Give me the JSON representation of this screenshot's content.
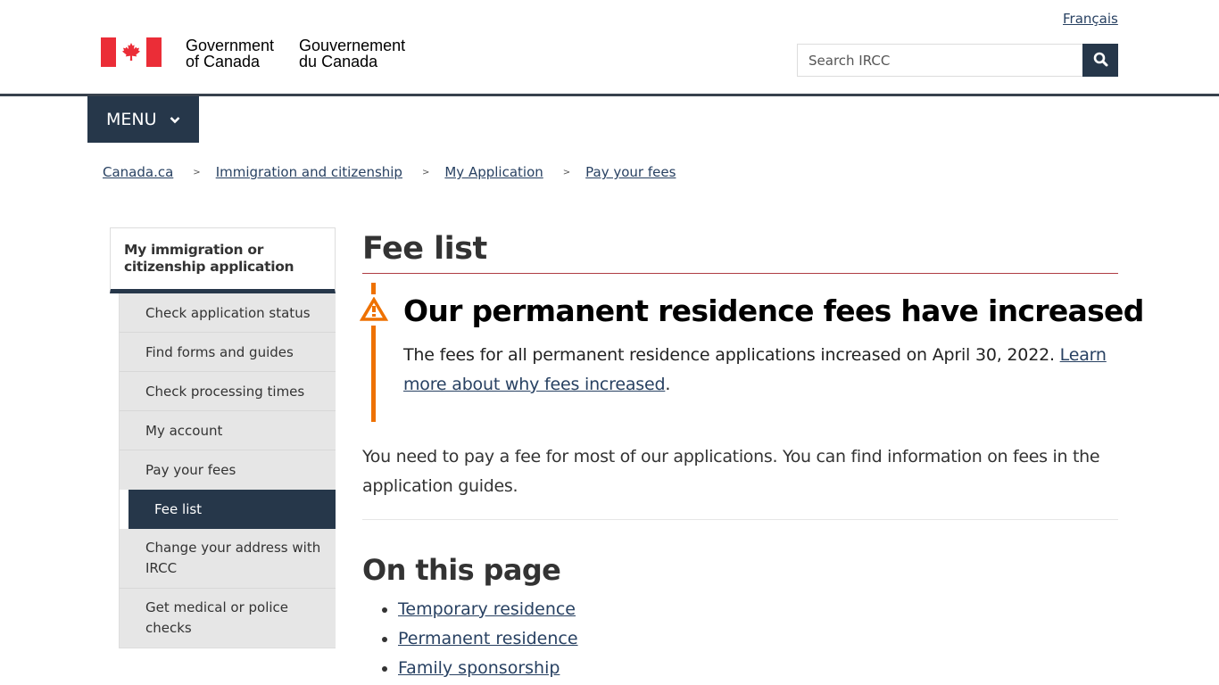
{
  "header": {
    "logo": {
      "en_line1": "Government",
      "en_line2": "of Canada",
      "fr_line1": "Gouvernement",
      "fr_line2": "du Canada",
      "flag_color": "#eb2d37"
    },
    "language_link": "Français",
    "search": {
      "placeholder": "Search IRCC",
      "value": "",
      "button_icon": "search-icon"
    }
  },
  "menu": {
    "label": "MENU",
    "icon": "chevron-down-icon"
  },
  "breadcrumb": [
    {
      "label": "Canada.ca"
    },
    {
      "label": "Immigration and citizenship"
    },
    {
      "label": "My Application"
    },
    {
      "label": "Pay your fees"
    }
  ],
  "breadcrumb_separator": ">",
  "sidenav": {
    "heading": "My immigration or citizenship application",
    "items": [
      {
        "label": "Check application status"
      },
      {
        "label": "Find forms and guides"
      },
      {
        "label": "Check processing times"
      },
      {
        "label": "My account"
      },
      {
        "label": "Pay your fees"
      },
      {
        "label": "Fee list",
        "active": true
      },
      {
        "label": "Change your address with IRCC"
      },
      {
        "label": "Get medical or police checks"
      }
    ]
  },
  "main": {
    "title": "Fee list",
    "alert": {
      "type": "warning",
      "icon": "warning-icon",
      "color": "#ee7100",
      "heading": "Our permanent residence fees have increased",
      "text": "The fees for all permanent residence applications increased on April 30, 2022. ",
      "link_text": "Learn more about why fees increased",
      "after_link": "."
    },
    "intro": "You need to pay a fee for most of our applications. You can find information on fees in the application guides.",
    "toc_title": "On this page",
    "toc": [
      {
        "label": "Temporary residence"
      },
      {
        "label": "Permanent residence"
      },
      {
        "label": "Family sponsorship"
      }
    ]
  },
  "colors": {
    "primary_dark": "#26374a",
    "link": "#284162",
    "title_underline": "#af3c43",
    "warning": "#ee7100"
  }
}
